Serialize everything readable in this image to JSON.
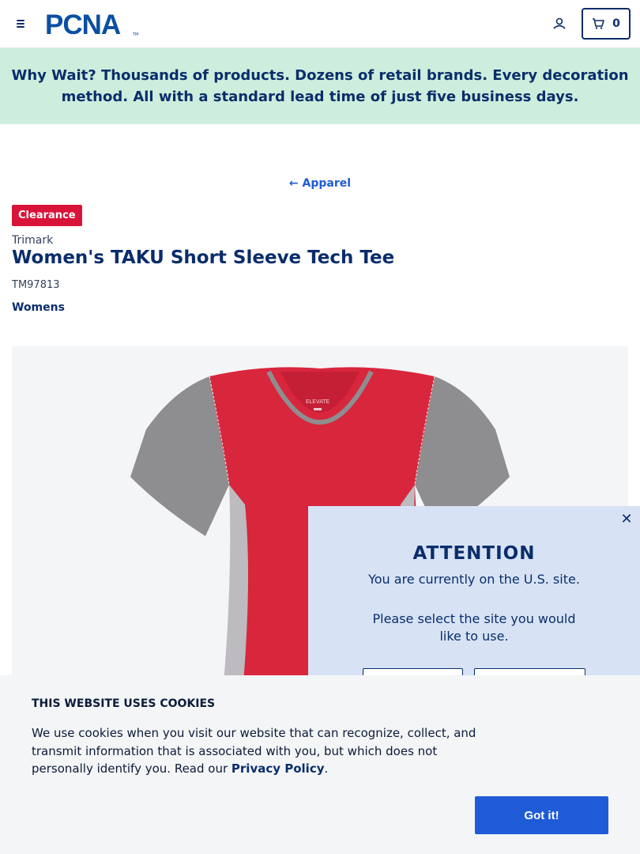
{
  "header": {
    "logo_text": "PCNA",
    "cart_count": "0"
  },
  "promo": {
    "text": "Why Wait? Thousands of products. Dozens of retail brands. Every decoration method. All with a standard lead time of just five business days."
  },
  "breadcrumb": {
    "back_label": "Apparel"
  },
  "product": {
    "badge": "Clearance",
    "brand": "Trimark",
    "title": "Women's TAKU Short Sleeve Tech Tee",
    "sku": "TM97813",
    "category": "Womens",
    "label_text": "ELEVATE",
    "colors": {
      "body": "#d8263d",
      "sleeve": "#8e8d8f"
    }
  },
  "modal": {
    "close": "✕",
    "title": "ATTENTION",
    "subtitle": "You are currently on the U.S. site.",
    "prompt": "Please select the site you would like to use."
  },
  "cookie": {
    "title": "THIS WEBSITE USES COOKIES",
    "text_before": "We use cookies when you visit our website that can recognize, collect, and transmit information that is associated with you, but which does not personally identify you. Read our ",
    "link": "Privacy Policy",
    "text_after": ".",
    "button": "Got it!"
  },
  "colors": {
    "navy": "#0a2d6b",
    "accent_blue": "#1f5bd6",
    "promo_bg": "#cdeedc",
    "badge_red": "#d8143a",
    "modal_bg": "#d7e3f5"
  }
}
